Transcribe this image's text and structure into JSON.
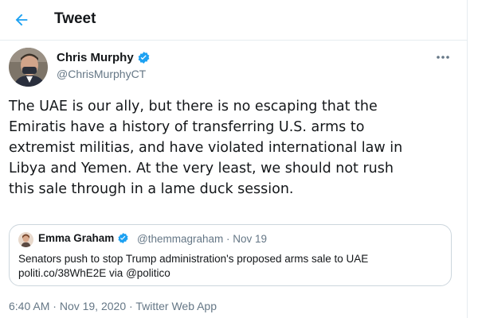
{
  "colors": {
    "accent": "#1da1f2",
    "text_primary": "#14171a",
    "text_secondary": "#657786",
    "border": "#e6ecf0"
  },
  "header": {
    "back_icon": "arrow-left-icon",
    "title": "Tweet"
  },
  "tweet": {
    "author_name": "Chris Murphy",
    "author_handle": "@ChrisMurphyCT",
    "verified": true,
    "more_icon": "ellipsis-icon",
    "text_lines": [
      "The UAE is our ally, but there is no escaping that the",
      "Emiratis have a history of transferring U.S. arms to",
      "extremist militias, and have violated international law in",
      "Libya and Yemen. At the very least, we should not rush",
      "this sale through in a lame duck session."
    ],
    "quote": {
      "author_name": "Emma Graham",
      "author_handle": "@themmagraham",
      "separator": "·",
      "date": "Nov 19",
      "text_lines": [
        "Senators push to stop Trump administration's proposed arms sale to UAE",
        "politi.co/38WhE2E via @politico"
      ]
    },
    "time": "6:40 AM",
    "separator": "·",
    "date": "Nov 19, 2020",
    "app": "Twitter Web App"
  }
}
